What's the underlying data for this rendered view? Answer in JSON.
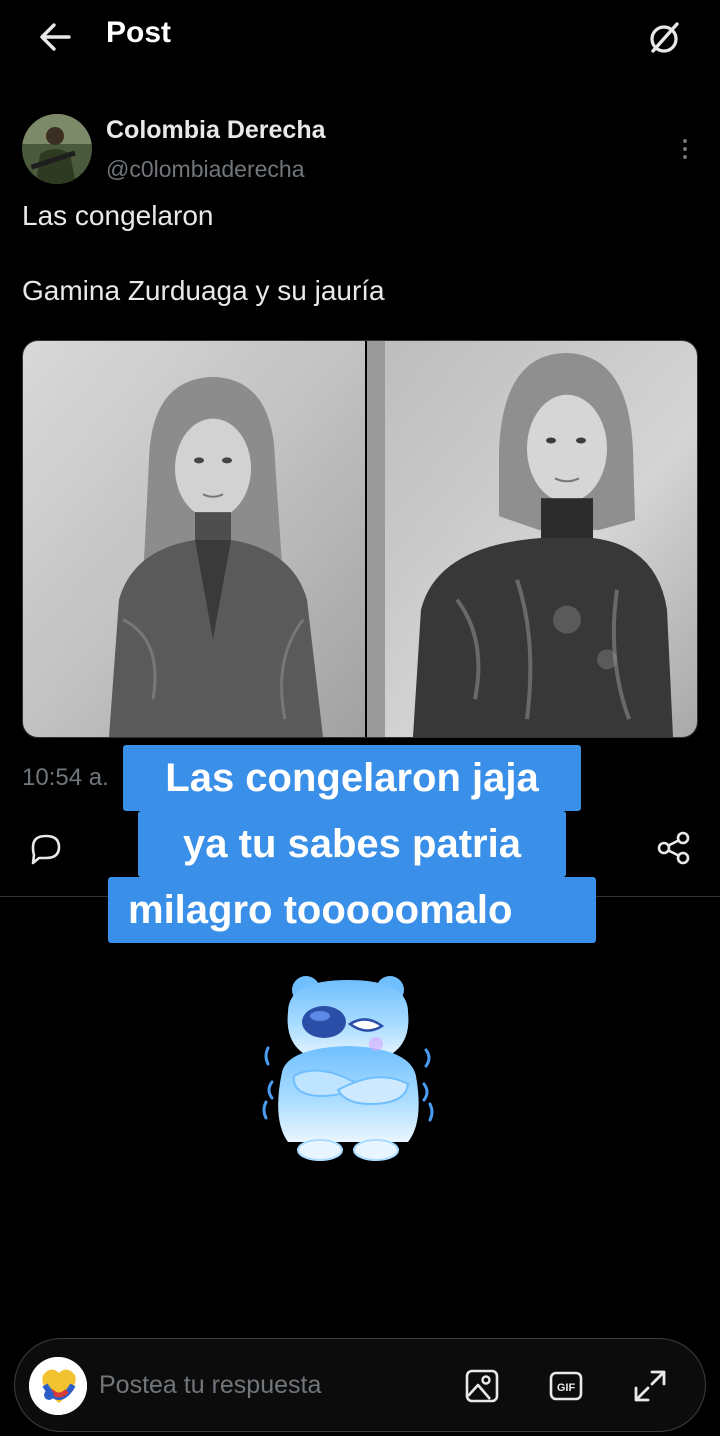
{
  "header": {
    "title": "Post",
    "back_icon": "arrow-left-icon",
    "grok_icon": "grok-icon"
  },
  "post": {
    "author_name": "Colombia Derecha",
    "author_handle": "@c0lombiaderecha",
    "text_line1": "Las congelaron",
    "text_line2": "Gamina Zurduaga y su jauría",
    "timestamp": "10:54 a.",
    "media": [
      "frozen-woman-portrait-left",
      "frozen-woman-portrait-right"
    ]
  },
  "actions": {
    "reply_icon": "reply-icon",
    "share_icon": "share-icon"
  },
  "overlay_caption": {
    "line1": "Las congelaron jaja",
    "line2": "ya tu sabes patria",
    "line3": "milagro tooooomalo",
    "background": "#3a8fe8"
  },
  "composer": {
    "placeholder": "Postea tu respuesta",
    "image_icon": "image-icon",
    "gif_label": "GIF",
    "expand_icon": "expand-icon"
  },
  "colors": {
    "background": "#000000",
    "text": "#e7e9ea",
    "secondary": "#71767b",
    "divider": "#2f3336"
  }
}
